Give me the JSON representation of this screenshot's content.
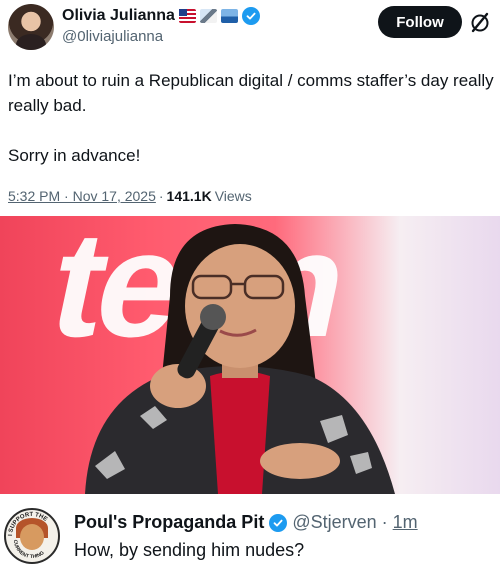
{
  "tweet": {
    "author": {
      "display_name": "Olivia Julianna",
      "handle": "@0liviajulianna",
      "emojis": [
        "us-flag-emoji",
        "mountain-emoji",
        "ballot-box-emoji"
      ],
      "verified": true
    },
    "follow_label": "Follow",
    "text": "I’m about to ruin a Republican digital / comms staffer’s day really really bad.\n\nSorry in advance!",
    "time": "5:32 PM · Nov 17, 2025",
    "separator": "·",
    "views_count": "141.1K",
    "views_label": "Views",
    "photo_banner_text": "teen"
  },
  "reply": {
    "display_name": "Poul's Propaganda Pit",
    "handle": "@Stjerven",
    "separator": "·",
    "time": "1m",
    "text": "How, by sending him nudes?",
    "avatar_text_top": "I SUPPORT THE",
    "avatar_text_bottom": "CURRENT THING"
  },
  "colors": {
    "text_primary": "#0f1419",
    "text_secondary": "#536471",
    "verified_blue": "#1d9bf0",
    "follow_bg": "#0f1419"
  }
}
